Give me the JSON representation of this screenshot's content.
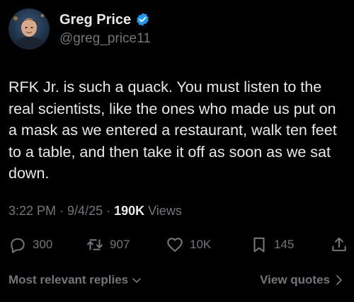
{
  "author": {
    "display_name": "Greg Price",
    "handle": "@greg_price11",
    "verified": true,
    "verified_color": "#1d9bf0"
  },
  "tweet": {
    "text": "RFK Jr. is such a quack. You must listen to the real scientists, like the ones who made us put on a mask as we entered a restaurant, walk ten feet to a table, and then take it off as soon as we sat down.",
    "time": "3:22 PM",
    "date": "9/4/25",
    "separator": "·",
    "views_count": "190K",
    "views_label": "Views"
  },
  "actions": {
    "replies": "300",
    "reposts": "907",
    "likes": "10K",
    "bookmarks": "145"
  },
  "footer": {
    "sort_label": "Most relevant replies",
    "view_quotes_label": "View quotes"
  },
  "icons": {
    "reply": "reply-icon",
    "repost": "repost-icon",
    "like": "heart-icon",
    "bookmark": "bookmark-icon",
    "share": "share-icon",
    "chevron_down": "chevron-down-icon",
    "chevron_right": "chevron-right-icon"
  },
  "colors": {
    "background": "#000000",
    "primary_text": "#e7e9ea",
    "secondary_text": "#71767b"
  }
}
